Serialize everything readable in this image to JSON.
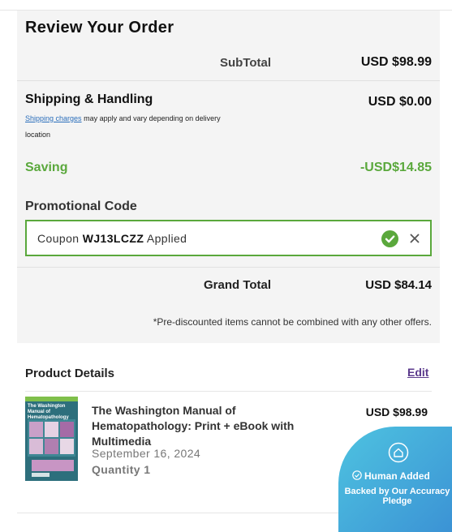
{
  "summary": {
    "title": "Review Your Order",
    "subtotal_label": "SubTotal",
    "subtotal_value": "USD $98.99",
    "shipping_label": "Shipping & Handling",
    "shipping_value": "USD $0.00",
    "shipping_link": "Shipping charges",
    "shipping_note": "may apply and vary depending on delivery location",
    "saving_label": "Saving",
    "saving_value": "-USD$14.85",
    "promo_label": "Promotional Code",
    "promo_prefix": "Coupon",
    "promo_code": "WJ13LCZZ",
    "promo_suffix": "Applied",
    "grand_total_label": "Grand Total",
    "grand_total_value": "USD $84.14",
    "disclaimer": "*Pre-discounted items cannot be combined with any other offers."
  },
  "product_details": {
    "title": "Product Details",
    "edit_label": "Edit",
    "item": {
      "name": "The Washington Manual of Hematopathology: Print + eBook with Multimedia",
      "date": "September 16, 2024",
      "quantity": "Quantity 1",
      "price": "USD $98.99",
      "cover_title": "The Washington Manual of Hematopathology"
    }
  },
  "badge": {
    "title": "Human Added",
    "subtitle": "Backed by Our Accuracy Pledge"
  },
  "colors": {
    "accent_green": "#5aa83c",
    "link_blue": "#2a6ebb",
    "edit_purple": "#5b3a8c",
    "badge_start": "#4ec3e0",
    "badge_end": "#3a8fd4"
  }
}
